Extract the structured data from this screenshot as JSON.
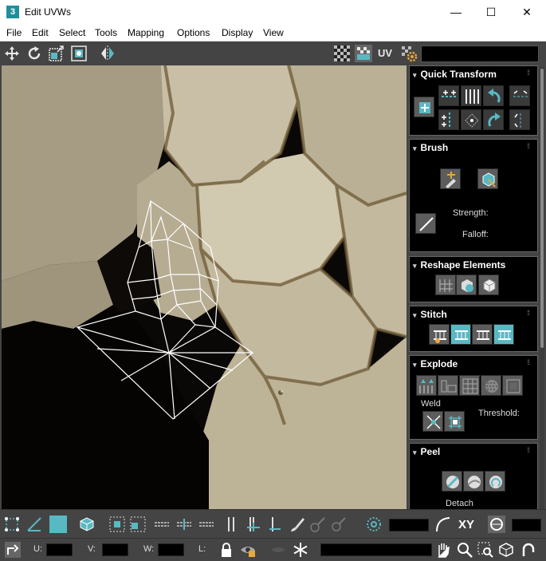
{
  "window": {
    "app_icon_text": "3",
    "title": "Edit UVWs",
    "minimize_glyph": "—",
    "maximize_glyph": "☐",
    "close_glyph": "✕"
  },
  "menu": [
    "File",
    "Edit",
    "Select",
    "Tools",
    "Mapping",
    "Options",
    "Display",
    "View"
  ],
  "toolbar_top": {
    "uv_label": "UV"
  },
  "panel": {
    "quick_transform": {
      "title": "Quick Transform"
    },
    "brush": {
      "title": "Brush",
      "strength_label": "Strength:",
      "falloff_label": "Falloff:"
    },
    "reshape": {
      "title": "Reshape Elements"
    },
    "stitch": {
      "title": "Stitch"
    },
    "explode": {
      "title": "Explode",
      "weld_label": "Weld",
      "threshold_label": "Threshold:"
    },
    "peel": {
      "title": "Peel",
      "detach_label": "Detach"
    }
  },
  "bottom": {
    "xy_label": "XY",
    "u_label": "U:",
    "v_label": "V:",
    "w_label": "W:",
    "l_label": "L:"
  },
  "colors": {
    "accent": "#59b9c3",
    "panel_bg": "#444444",
    "rollout_bg": "#000000",
    "wire": "#ffffff"
  }
}
